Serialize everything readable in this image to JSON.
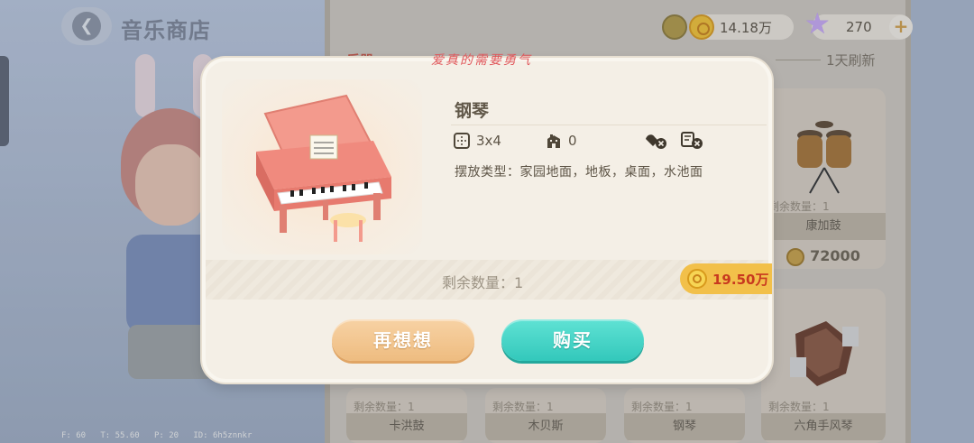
{
  "header": {
    "back_icon": "chevron-left-icon",
    "title": "音乐商店"
  },
  "currency": {
    "coins": "14.18万",
    "stars": "270",
    "coin_color": "#f3c335",
    "star_color": "#c9a9f5"
  },
  "shop": {
    "tab_label": "乐器",
    "refresh_text": "1天刷新",
    "cards": [
      {
        "name": "康加鼓",
        "remain": "剩余数量：1",
        "price": "72000"
      },
      {
        "name": "卡洪鼓",
        "remain": "剩余数量：1"
      },
      {
        "name": "木贝斯",
        "remain": "剩余数量：1"
      },
      {
        "name": "钢琴",
        "remain": "剩余数量：1"
      },
      {
        "name": "六角手风琴",
        "remain": "剩余数量：1"
      }
    ]
  },
  "watermark": "爱真的需要勇气",
  "debug": {
    "f": "F: 60",
    "t": "T: 55.60",
    "p": "P: 20",
    "id": "ID: 6h5znnkr"
  },
  "dialog": {
    "item_name": "钢琴",
    "size": "3x4",
    "comfort": "0",
    "placement": "摆放类型：家园地面，地板，桌面，水池面",
    "remain": "剩余数量：1",
    "price": "19.50万",
    "cancel_label": "再想想",
    "buy_label": "购买",
    "accent_cancel": "#eebc80",
    "accent_buy": "#33c8bb"
  }
}
